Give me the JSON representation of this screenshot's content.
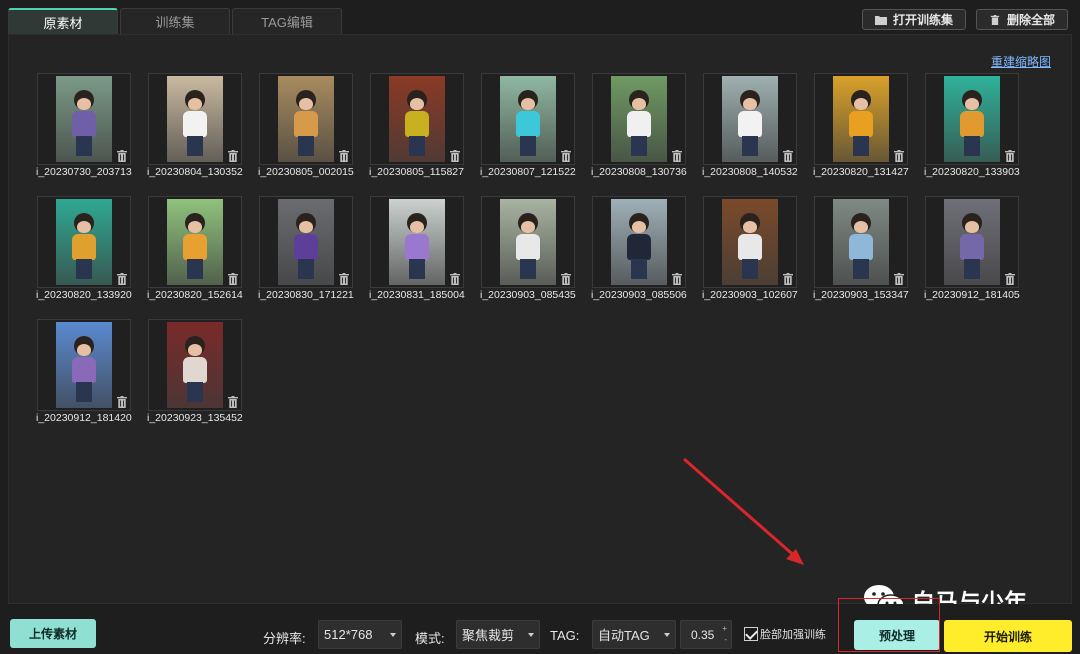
{
  "tabs": [
    {
      "label": "原素材",
      "active": true
    },
    {
      "label": "训练集",
      "active": false
    },
    {
      "label": "TAG编辑",
      "active": false
    }
  ],
  "top_actions": {
    "open_training_set": "打开训练集",
    "delete_all": "删除全部"
  },
  "rebuild_thumbnails": "重建缩略图",
  "thumbnails": [
    {
      "name": "i_20230730_203713",
      "bg": "#7b9a87",
      "shirt": "#6f5fa8"
    },
    {
      "name": "i_20230804_130352",
      "bg": "#c9b9a0",
      "shirt": "#f2f2f2"
    },
    {
      "name": "i_20230805_002015",
      "bg": "#a88b5f",
      "shirt": "#d79a4a"
    },
    {
      "name": "i_20230805_115827",
      "bg": "#8a3a25",
      "shirt": "#c8b020"
    },
    {
      "name": "i_20230807_121522",
      "bg": "#8fb8a2",
      "shirt": "#3cc8d8"
    },
    {
      "name": "i_20230808_130736",
      "bg": "#6f9a63",
      "shirt": "#f0f0f0"
    },
    {
      "name": "i_20230808_140532",
      "bg": "#9fb0b0",
      "shirt": "#f2f2f2"
    },
    {
      "name": "i_20230820_131427",
      "bg": "#d9a12a",
      "shirt": "#e8a020"
    },
    {
      "name": "i_20230820_133903",
      "bg": "#2fb29a",
      "shirt": "#e09a30"
    },
    {
      "name": "i_20230820_133920",
      "bg": "#2fa892",
      "shirt": "#e0a030"
    },
    {
      "name": "i_20230820_152614",
      "bg": "#8fc27d",
      "shirt": "#e8a030"
    },
    {
      "name": "i_20230830_171221",
      "bg": "#6a6c70",
      "shirt": "#5d3f9a"
    },
    {
      "name": "i_20230831_185004",
      "bg": "#cbd1cf",
      "shirt": "#9a78d0"
    },
    {
      "name": "i_20230903_085435",
      "bg": "#a9b4a2",
      "shirt": "#e8e8e8"
    },
    {
      "name": "i_20230903_085506",
      "bg": "#9fb0b8",
      "shirt": "#202838"
    },
    {
      "name": "i_20230903_102607",
      "bg": "#7a4a2a",
      "shirt": "#e8e8e8"
    },
    {
      "name": "i_20230903_153347",
      "bg": "#7f8a84",
      "shirt": "#8fb8d8"
    },
    {
      "name": "i_20230912_181405",
      "bg": "#6f6f78",
      "shirt": "#7468a8"
    },
    {
      "name": "i_20230912_181420",
      "bg": "#5a8ad0",
      "shirt": "#8a6ab8"
    },
    {
      "name": "i_20230923_135452",
      "bg": "#7a2a2a",
      "shirt": "#e0d8d0"
    }
  ],
  "bottom": {
    "upload": "上传素材",
    "resolution_label": "分辨率:",
    "resolution_value": "512*768",
    "mode_label": "模式:",
    "mode_value": "聚焦裁剪",
    "tag_label": "TAG:",
    "tag_value": "自动TAG",
    "threshold": "0.35",
    "threshold_up": "+",
    "threshold_down": "-",
    "face_enhance_label": "脸部加强训练",
    "face_enhance_checked": true,
    "preprocess": "预处理",
    "start_training": "开始训练"
  },
  "watermark": "白马与少年",
  "colors": {
    "accent_teal": "#8fe0d2",
    "start_yellow": "#ffec2a",
    "annotation_red": "#d8262b",
    "link_blue": "#7fb8ff"
  }
}
